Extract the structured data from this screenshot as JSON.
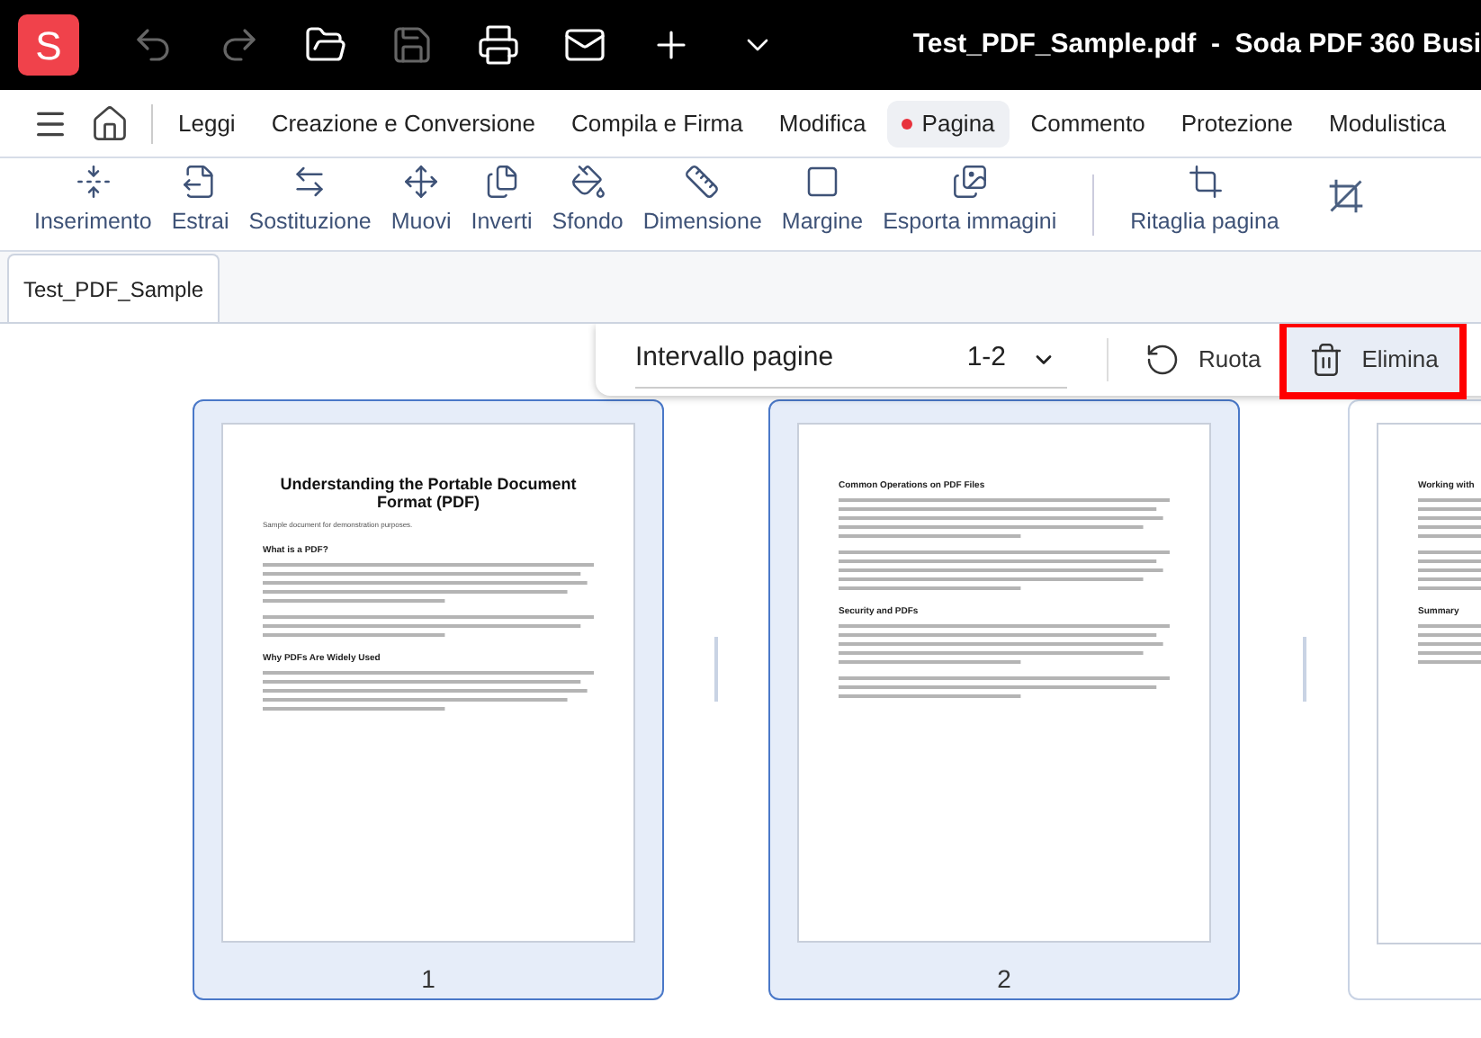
{
  "title_bar": {
    "logo": "S",
    "title": "Test_PDF_Sample.pdf  -  Soda PDF 360 Busi",
    "quick_actions": [
      {
        "kind": "undo",
        "disabled": true
      },
      {
        "kind": "redo",
        "disabled": true
      },
      {
        "kind": "open",
        "disabled": false
      },
      {
        "kind": "save",
        "disabled": true
      },
      {
        "kind": "print",
        "disabled": false
      },
      {
        "kind": "mail",
        "disabled": false
      },
      {
        "kind": "new",
        "disabled": false
      },
      {
        "kind": "more",
        "disabled": false
      }
    ]
  },
  "menu_tabs": [
    {
      "label": "Leggi",
      "selected": false
    },
    {
      "label": "Creazione e Conversione",
      "selected": false
    },
    {
      "label": "Compila e Firma",
      "selected": false
    },
    {
      "label": "Modifica",
      "selected": false
    },
    {
      "label": "Pagina",
      "selected": true
    },
    {
      "label": "Commento",
      "selected": false
    },
    {
      "label": "Protezione",
      "selected": false
    },
    {
      "label": "Modulistica",
      "selected": false
    }
  ],
  "tools": [
    {
      "kind": "insert",
      "label": "Inserimento"
    },
    {
      "kind": "extract",
      "label": "Estrai"
    },
    {
      "kind": "replace",
      "label": "Sostituzione"
    },
    {
      "kind": "move",
      "label": "Muovi"
    },
    {
      "kind": "reverse",
      "label": "Inverti"
    },
    {
      "kind": "background",
      "label": "Sfondo"
    },
    {
      "kind": "size",
      "label": "Dimensione"
    },
    {
      "kind": "margin",
      "label": "Margine"
    },
    {
      "kind": "export",
      "label": "Esporta immagini"
    },
    {
      "kind": "separator"
    },
    {
      "kind": "crop",
      "label": "Ritaglia pagina"
    },
    {
      "kind": "uncrop"
    }
  ],
  "document_tabs": [
    {
      "label": "Test_PDF_Sample",
      "selected": true
    }
  ],
  "page_toolbar": {
    "range_label": "Intervallo pagine",
    "range_value": "1-2",
    "buttons": [
      {
        "kind": "rotate",
        "label": "Ruota",
        "highlighted": false
      },
      {
        "kind": "delete",
        "label": "Elimina",
        "highlighted": true
      }
    ]
  },
  "pages": [
    {
      "number": "1",
      "selected": true,
      "blocks": [
        {
          "kind": "title",
          "text": "Understanding the Portable Document Format (PDF)"
        },
        {
          "kind": "subtitle",
          "text": "Sample document for demonstration purposes."
        },
        {
          "kind": "heading",
          "text": "What is a PDF?"
        },
        {
          "kind": "paragraph"
        },
        {
          "kind": "short-paragraph"
        },
        {
          "kind": "heading",
          "text": "Why PDFs Are Widely Used"
        },
        {
          "kind": "paragraph"
        }
      ]
    },
    {
      "number": "2",
      "selected": true,
      "blocks": [
        {
          "kind": "heading",
          "text": "Common Operations on PDF Files"
        },
        {
          "kind": "paragraph"
        },
        {
          "kind": "paragraph"
        },
        {
          "kind": "heading",
          "text": "Security and PDFs"
        },
        {
          "kind": "paragraph"
        },
        {
          "kind": "short-paragraph"
        }
      ]
    },
    {
      "selected": false,
      "blocks": [
        {
          "kind": "heading",
          "text": "Working with"
        },
        {
          "kind": "paragraph"
        },
        {
          "kind": "paragraph"
        },
        {
          "kind": "heading",
          "text": "Summary"
        },
        {
          "kind": "paragraph"
        }
      ]
    }
  ]
}
